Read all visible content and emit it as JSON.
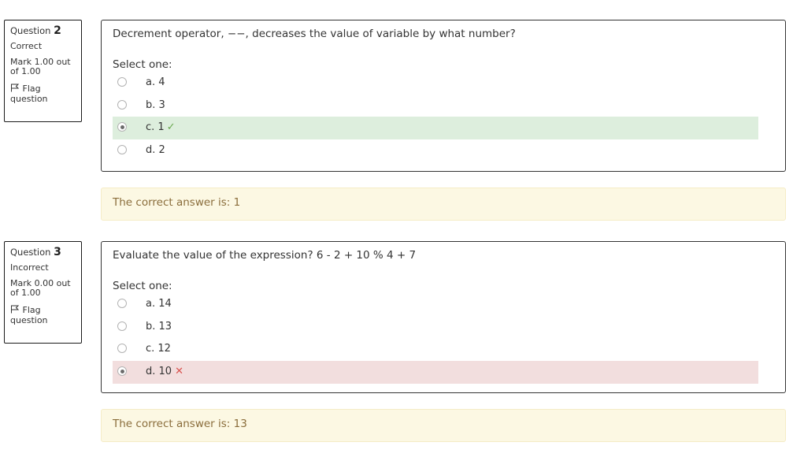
{
  "questions": [
    {
      "label": "Question",
      "number": "2",
      "state": "Correct",
      "grade": "Mark 1.00 out of 1.00",
      "flag_label": "Flag question",
      "text": "Decrement operator, −−, decreases the value of variable by what number?",
      "prompt": "Select one:",
      "answers": [
        {
          "label": "a. 4",
          "selected": false,
          "result": ""
        },
        {
          "label": "b. 3",
          "selected": false,
          "result": ""
        },
        {
          "label": "c. 1",
          "selected": true,
          "result": "correct"
        },
        {
          "label": "d. 2",
          "selected": false,
          "result": ""
        }
      ],
      "feedback": "The correct answer is: 1"
    },
    {
      "label": "Question",
      "number": "3",
      "state": "Incorrect",
      "grade": "Mark 0.00 out of 1.00",
      "flag_label": "Flag question",
      "text": "Evaluate the value of the expression? 6 - 2 + 10 % 4 + 7",
      "prompt": "Select one:",
      "answers": [
        {
          "label": "a. 14",
          "selected": false,
          "result": ""
        },
        {
          "label": "b. 13",
          "selected": false,
          "result": ""
        },
        {
          "label": "c. 12",
          "selected": false,
          "result": ""
        },
        {
          "label": "d. 10",
          "selected": true,
          "result": "incorrect"
        }
      ],
      "feedback": "The correct answer is: 13"
    }
  ],
  "icons": {
    "flag": "flag-icon",
    "correct": "check-icon",
    "incorrect": "cross-icon"
  },
  "colors": {
    "correct_bg": "#ddeedd",
    "incorrect_bg": "#f2dede",
    "feedback_bg": "#fcf8e3",
    "check": "#6aa84f",
    "cross": "#d9534f"
  }
}
